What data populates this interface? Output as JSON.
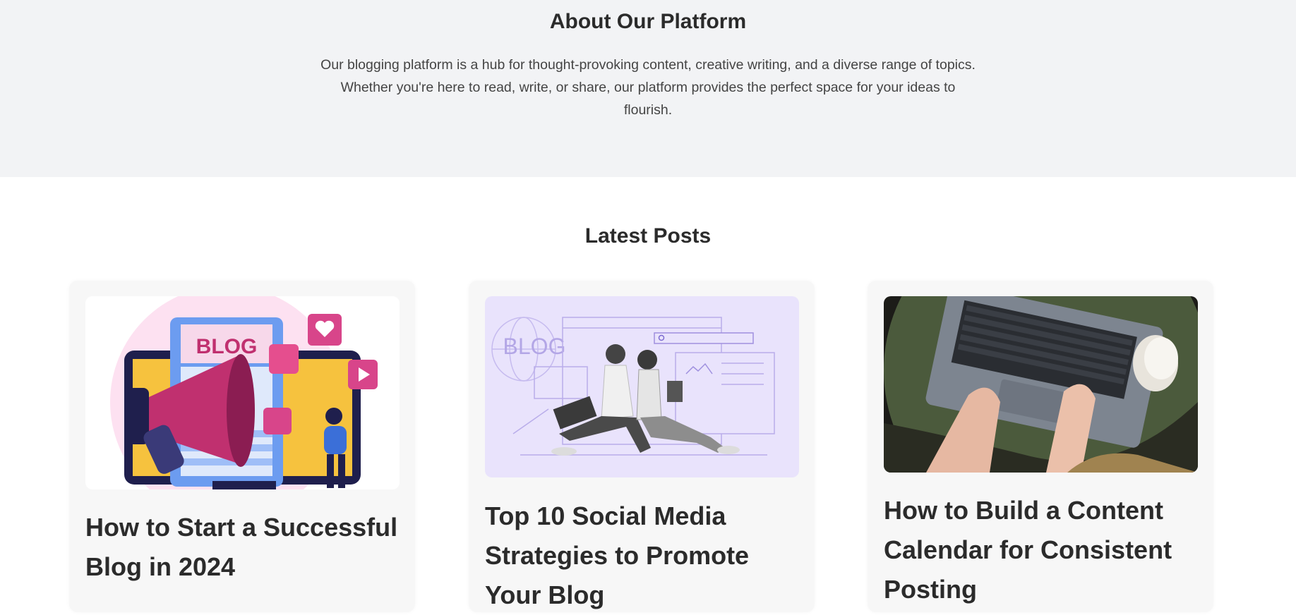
{
  "about": {
    "title": "About Our Platform",
    "description_lines": [
      "Our blogging platform is a hub for thought-provoking content, creative writing, and a diverse range of topics.",
      "Whether you're here to read, write, or share, our platform provides the perfect space for your ideas to",
      "flourish."
    ]
  },
  "latest": {
    "title": "Latest Posts",
    "posts": [
      {
        "title": "How to Start a Successful Blog in 2024",
        "image_text": "BLOG"
      },
      {
        "title": "Top 10 Social Media Strategies to Promote Your Blog",
        "image_text": "BLOG"
      },
      {
        "title": "How to Build a Content Calendar for Consistent Posting"
      }
    ]
  },
  "colors": {
    "about_bg": "#f2f3f5",
    "card_bg": "#f7f7f7",
    "heading": "#2b2b2b",
    "body_text": "#444444",
    "illustration_purple": "#e9e3fc",
    "illustration_magenta": "#c0306f",
    "laptop_desk_green": "#4b5a3c"
  }
}
